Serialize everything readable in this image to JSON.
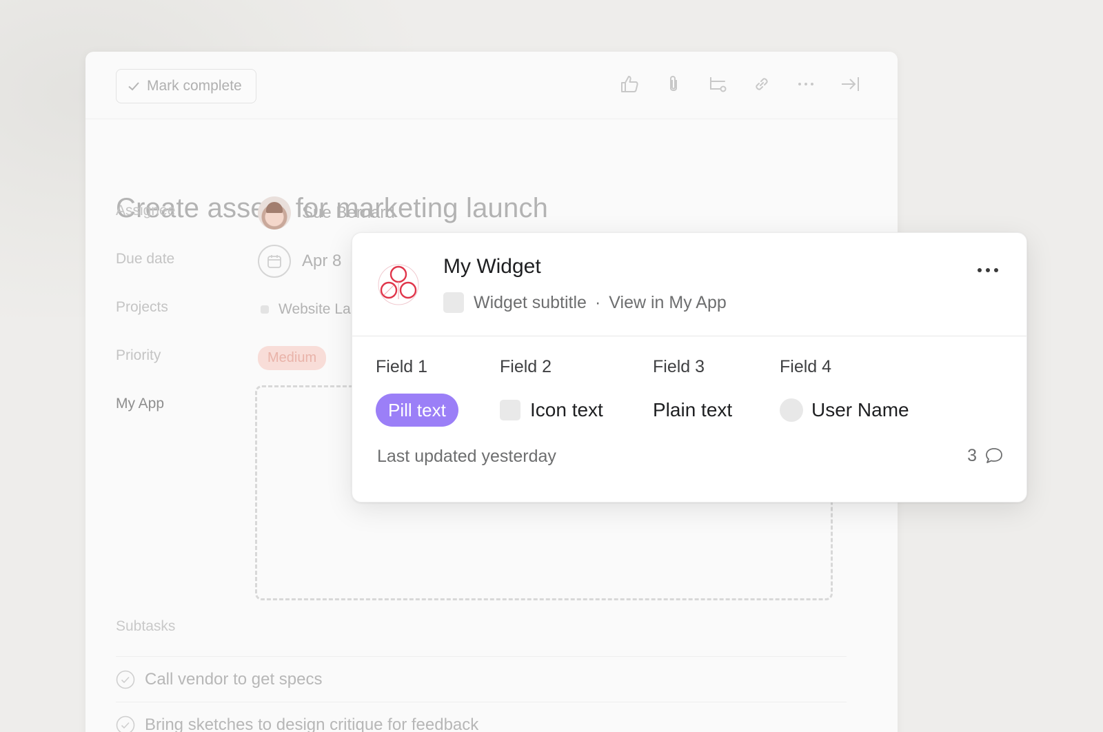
{
  "toolbar": {
    "mark_complete_label": "Mark complete",
    "icons": [
      "thumbs-up-icon",
      "paperclip-icon",
      "subtask-icon",
      "link-icon",
      "more-icon",
      "close-pane-icon"
    ]
  },
  "task": {
    "title": "Create assets for marketing launch",
    "fields": {
      "assignee_label": "Assignee",
      "assignee_value": "Sue Bernard",
      "due_label": "Due date",
      "due_value": "Apr 8",
      "projects_label": "Projects",
      "projects_value": "Website La",
      "priority_label": "Priority",
      "priority_value": "Medium",
      "myapp_label": "My App"
    },
    "subtasks_label": "Subtasks",
    "subtasks": [
      "Call vendor to get specs",
      "Bring sketches to design critique for feedback"
    ]
  },
  "widget": {
    "title": "My Widget",
    "subtitle": "Widget subtitle",
    "separator": "·",
    "view_link": "View in My App",
    "fields": [
      {
        "label": "Field 1",
        "value": "Pill text"
      },
      {
        "label": "Field 2",
        "value": "Icon text"
      },
      {
        "label": "Field 3",
        "value": "Plain text"
      },
      {
        "label": "Field 4",
        "value": "User Name"
      }
    ],
    "footer": "Last updated yesterday",
    "comment_count": "3",
    "colors": {
      "pill": "#9b7ff7",
      "logo": "#e0354a"
    }
  }
}
